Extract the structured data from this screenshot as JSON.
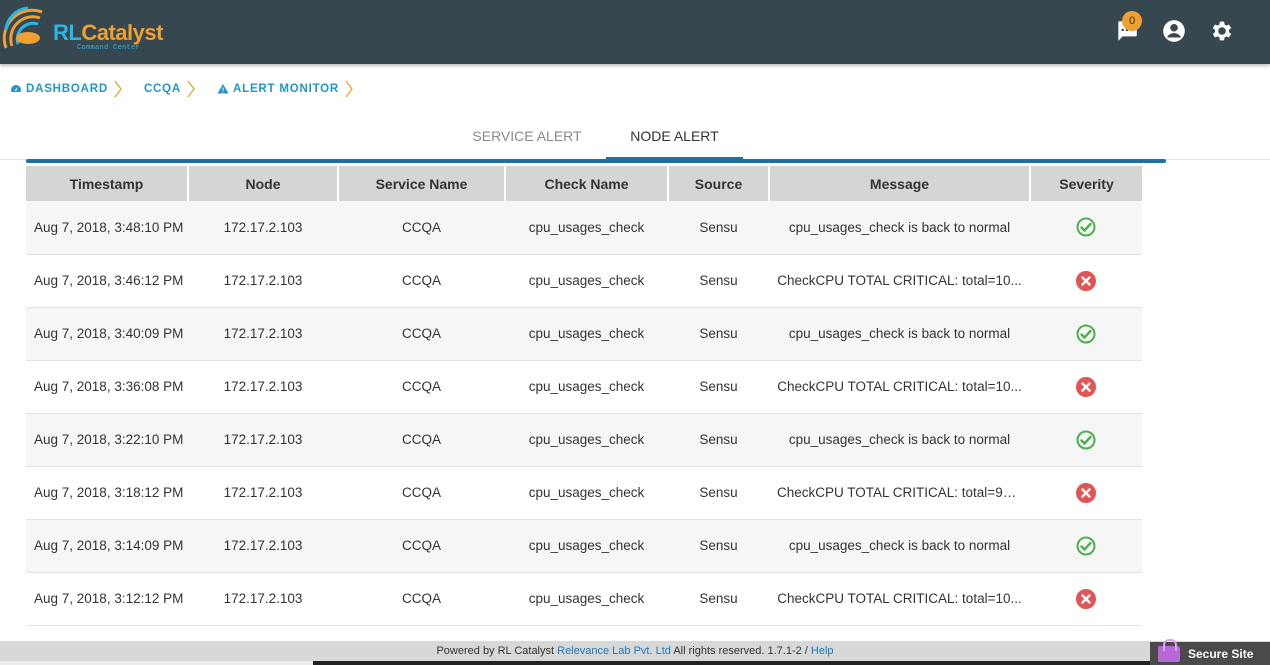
{
  "app": {
    "logo_rl": "RL",
    "logo_catalyst": "Catalyst",
    "logo_subtitle": "Command Center",
    "notification_count": "0"
  },
  "icons": {
    "notifications": "chat-bubble-icon",
    "user": "account-circle-icon",
    "settings": "gear-icon",
    "dashboard": "speedometer-icon",
    "alert": "warning-triangle-icon",
    "ok": "check-circle-icon",
    "critical": "x-circle-icon"
  },
  "breadcrumb": [
    {
      "label": "DASHBOARD"
    },
    {
      "label": "CCQA"
    },
    {
      "label": "ALERT MONITOR"
    }
  ],
  "tabs": [
    {
      "label": "SERVICE ALERT",
      "active": false
    },
    {
      "label": "NODE ALERT",
      "active": true
    }
  ],
  "table": {
    "columns": [
      "Timestamp",
      "Node",
      "Service Name",
      "Check Name",
      "Source",
      "Message",
      "Severity"
    ],
    "rows": [
      {
        "timestamp": "Aug 7, 2018, 3:48:10 PM",
        "node": "172.17.2.103",
        "service": "CCQA",
        "check": "cpu_usages_check",
        "source": "Sensu",
        "message": "cpu_usages_check is back to normal",
        "severity": "ok"
      },
      {
        "timestamp": "Aug 7, 2018, 3:46:12 PM",
        "node": "172.17.2.103",
        "service": "CCQA",
        "check": "cpu_usages_check",
        "source": "Sensu",
        "message": "CheckCPU TOTAL CRITICAL: total=10...",
        "severity": "critical"
      },
      {
        "timestamp": "Aug 7, 2018, 3:40:09 PM",
        "node": "172.17.2.103",
        "service": "CCQA",
        "check": "cpu_usages_check",
        "source": "Sensu",
        "message": "cpu_usages_check is back to normal",
        "severity": "ok"
      },
      {
        "timestamp": "Aug 7, 2018, 3:36:08 PM",
        "node": "172.17.2.103",
        "service": "CCQA",
        "check": "cpu_usages_check",
        "source": "Sensu",
        "message": "CheckCPU TOTAL CRITICAL: total=10...",
        "severity": "critical"
      },
      {
        "timestamp": "Aug 7, 2018, 3:22:10 PM",
        "node": "172.17.2.103",
        "service": "CCQA",
        "check": "cpu_usages_check",
        "source": "Sensu",
        "message": "cpu_usages_check is back to normal",
        "severity": "ok"
      },
      {
        "timestamp": "Aug 7, 2018, 3:18:12 PM",
        "node": "172.17.2.103",
        "service": "CCQA",
        "check": "cpu_usages_check",
        "source": "Sensu",
        "message": "CheckCPU TOTAL CRITICAL: total=99....",
        "severity": "critical"
      },
      {
        "timestamp": "Aug 7, 2018, 3:14:09 PM",
        "node": "172.17.2.103",
        "service": "CCQA",
        "check": "cpu_usages_check",
        "source": "Sensu",
        "message": "cpu_usages_check is back to normal",
        "severity": "ok"
      },
      {
        "timestamp": "Aug 7, 2018, 3:12:12 PM",
        "node": "172.17.2.103",
        "service": "CCQA",
        "check": "cpu_usages_check",
        "source": "Sensu",
        "message": "CheckCPU TOTAL CRITICAL: total=10...",
        "severity": "critical"
      }
    ]
  },
  "colors": {
    "ok": "#4caf50",
    "critical": "#e25555",
    "accent": "#1f6fa0",
    "topbar": "#37474f"
  },
  "footer": {
    "powered_by": "Powered by RL Catalyst",
    "company": "Relevance Lab Pvt. Ltd",
    "rights": "All rights reserved. 1.7.1-2 /",
    "help": "Help"
  },
  "secure_site": "Secure Site"
}
